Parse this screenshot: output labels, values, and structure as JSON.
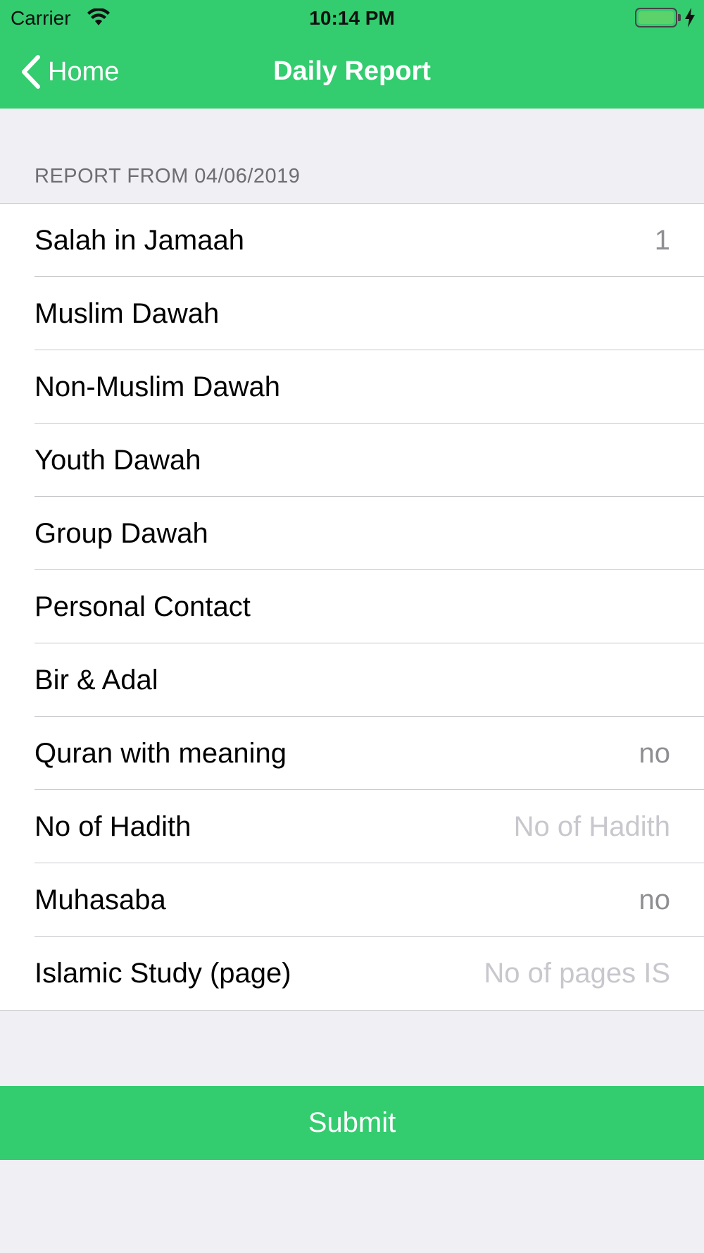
{
  "status_bar": {
    "carrier": "Carrier",
    "time": "10:14 PM"
  },
  "nav": {
    "back_label": "Home",
    "title": "Daily Report"
  },
  "section": {
    "header": "REPORT FROM 04/06/2019"
  },
  "rows": [
    {
      "label": "Salah in Jamaah",
      "value": "1",
      "placeholder": ""
    },
    {
      "label": "Muslim Dawah",
      "value": "",
      "placeholder": ""
    },
    {
      "label": "Non-Muslim Dawah",
      "value": "",
      "placeholder": ""
    },
    {
      "label": "Youth Dawah",
      "value": "",
      "placeholder": ""
    },
    {
      "label": "Group Dawah",
      "value": "",
      "placeholder": ""
    },
    {
      "label": "Personal Contact",
      "value": "",
      "placeholder": ""
    },
    {
      "label": "Bir & Adal",
      "value": "",
      "placeholder": ""
    },
    {
      "label": "Quran with meaning",
      "value": "no",
      "placeholder": ""
    },
    {
      "label": "No of Hadith",
      "value": "",
      "placeholder": "No of Hadith"
    },
    {
      "label": "Muhasaba",
      "value": "no",
      "placeholder": ""
    },
    {
      "label": "Islamic Study (page)",
      "value": "",
      "placeholder": "No of pages IS"
    }
  ],
  "submit": {
    "label": "Submit"
  },
  "colors": {
    "accent": "#33cc6f",
    "background": "#efeff4",
    "value_text": "#8e8e93",
    "placeholder_text": "#c7c7cd"
  }
}
